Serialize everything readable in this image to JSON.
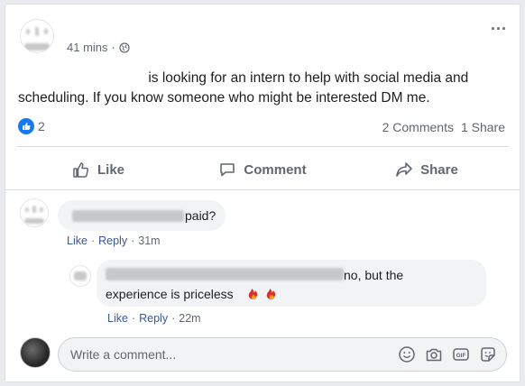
{
  "post": {
    "time": "41 mins",
    "dot": "·",
    "text": "is looking for an intern to help with social media and scheduling. If you know someone who might be interested DM me.",
    "reaction_count": "2",
    "comments_count": "2 Comments",
    "shares_count": "1 Share"
  },
  "actions": {
    "like": "Like",
    "comment": "Comment",
    "share": "Share"
  },
  "comments": [
    {
      "text_tail": "paid?",
      "like": "Like",
      "reply": "Reply",
      "time": "31m",
      "sep": "·"
    },
    {
      "text_tail": "no, but the",
      "text_line2": "experience is priceless",
      "like": "Like",
      "reply": "Reply",
      "time": "22m",
      "sep": "·"
    }
  ],
  "composer": {
    "placeholder": "Write a comment..."
  },
  "colors": {
    "brand": "#1877f2",
    "link": "#385898",
    "muted": "#606770"
  },
  "icons": [
    "globe-icon",
    "more-icon",
    "thumbs-up-icon",
    "comment-icon",
    "share-icon",
    "emoji-icon",
    "camera-icon",
    "gif-icon",
    "sticker-icon"
  ]
}
